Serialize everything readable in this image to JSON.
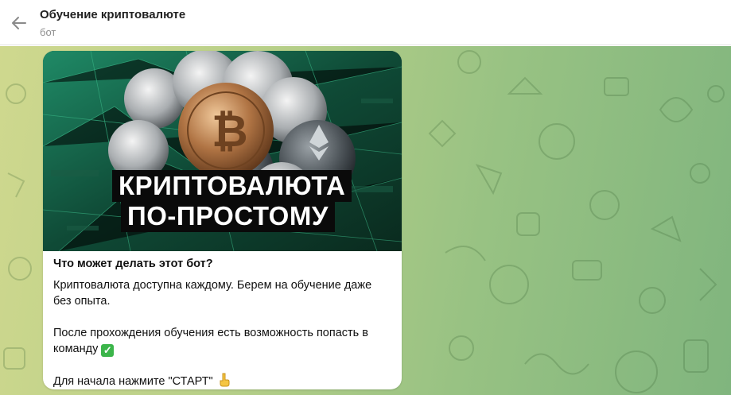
{
  "header": {
    "title": "Обучение криптовалюте",
    "subtitle": "бот",
    "back_icon": "arrow-left-icon"
  },
  "message": {
    "image_banner_line1": "КРИПТОВАЛЮТА",
    "image_banner_line2": "ПО-ПРОСТОМУ",
    "heading": "Что может делать этот бот?",
    "paragraph1": "Криптовалюта доступна каждому. Берем на обучение даже без опыта.",
    "paragraph2": "После прохождения обучения есть возможность попасть в команду",
    "paragraph2_emoji": "check-mark-icon",
    "paragraph3": "Для начала нажмите \"СТАРТ\"",
    "paragraph3_emoji": "pointing-down-hand-icon"
  },
  "colors": {
    "header_bg": "#ffffff",
    "chat_bg_left": "#cfd88e",
    "chat_bg_right": "#80b57e",
    "bubble_bg": "#ffffff",
    "check_green": "#3bb54a"
  }
}
